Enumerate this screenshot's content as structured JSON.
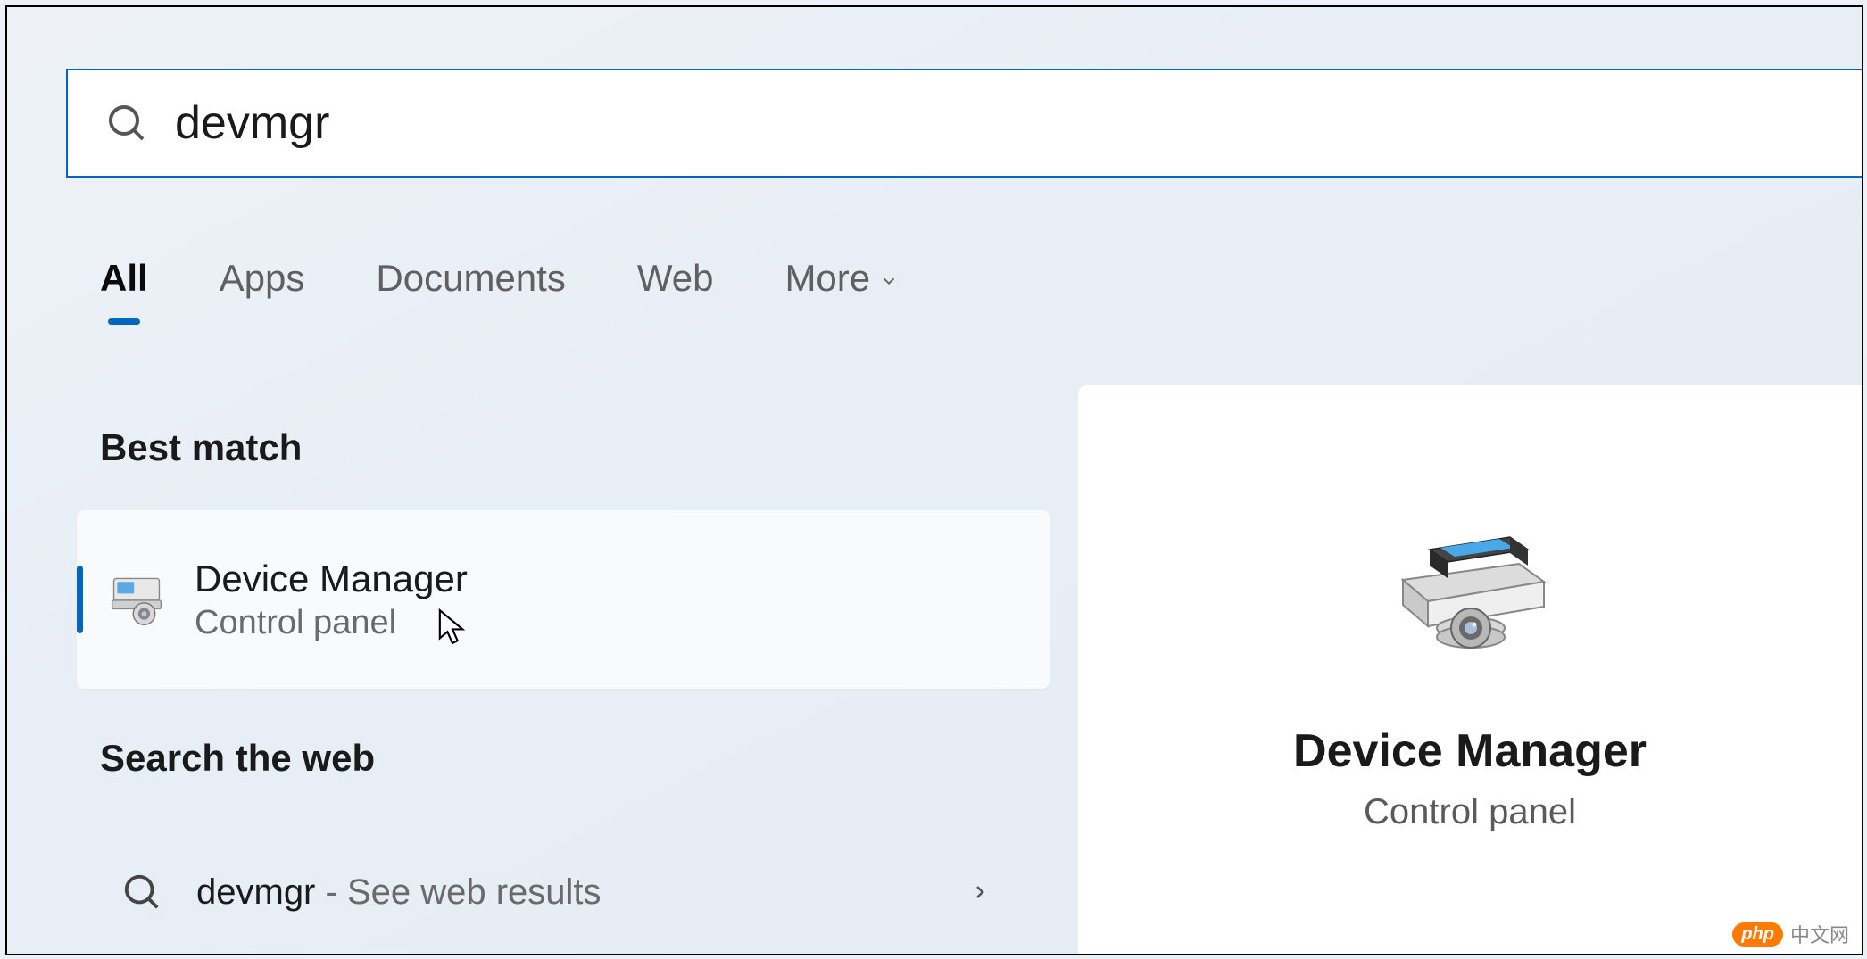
{
  "search": {
    "query": "devmgr"
  },
  "tabs": {
    "items": [
      {
        "label": "All",
        "active": true
      },
      {
        "label": "Apps",
        "active": false
      },
      {
        "label": "Documents",
        "active": false
      },
      {
        "label": "Web",
        "active": false
      },
      {
        "label": "More",
        "active": false,
        "hasChevron": true
      }
    ]
  },
  "sections": {
    "best_match_label": "Best match",
    "search_web_label": "Search the web"
  },
  "best_match": {
    "title": "Device Manager",
    "subtitle": "Control panel"
  },
  "web_result": {
    "query": "devmgr",
    "suffix": " - See web results"
  },
  "detail": {
    "title": "Device Manager",
    "subtitle": "Control panel"
  },
  "watermark": {
    "badge": "php",
    "text": "中文网"
  }
}
